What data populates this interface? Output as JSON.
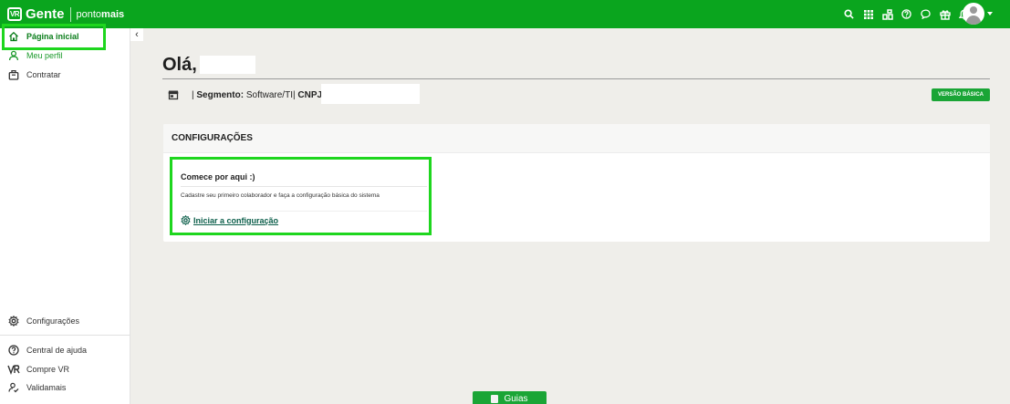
{
  "brand": {
    "name": "Gente",
    "mark": "VR",
    "sub_normal": "ponto",
    "sub_bold": "mais"
  },
  "header_icons": [
    "search-icon",
    "apps-grid-icon",
    "integrations-icon",
    "help-icon",
    "chat-icon",
    "gift-icon",
    "bell-icon"
  ],
  "sidebar": {
    "collapse_label": "‹",
    "items": [
      {
        "label": "Página inicial",
        "icon": "home-icon"
      },
      {
        "label": "Meu perfil",
        "icon": "user-icon"
      },
      {
        "label": "Contratar",
        "icon": "briefcase-icon"
      },
      {
        "label": "Configurações",
        "icon": "gear-icon"
      },
      {
        "label": "Central de ajuda",
        "icon": "help-circle-icon"
      },
      {
        "label": "Compre VR",
        "icon": "vr-icon"
      },
      {
        "label": "Validamais",
        "icon": "user-check-icon"
      }
    ]
  },
  "main": {
    "greeting": "Olá,",
    "info": {
      "sep1": "|",
      "segment_label": "Segmento:",
      "segment_value": "Software/TI",
      "sep2": "|",
      "cnpj_label": "CNPJ:"
    },
    "badge": "VERSÃO BÁSICA",
    "card": {
      "title": "CONFIGURAÇÕES",
      "setup": {
        "title": "Comece por aqui :)",
        "description": "Cadastre seu primeiro colaborador e faça a configuração básica do sistema",
        "link": "Iniciar a configuração"
      }
    }
  },
  "footer": {
    "guias": "Guias"
  },
  "colors": {
    "brand_green": "#0aa51e",
    "badge_green": "#1aa536",
    "highlight": "#1ed61e",
    "link": "#0b5e4a"
  }
}
